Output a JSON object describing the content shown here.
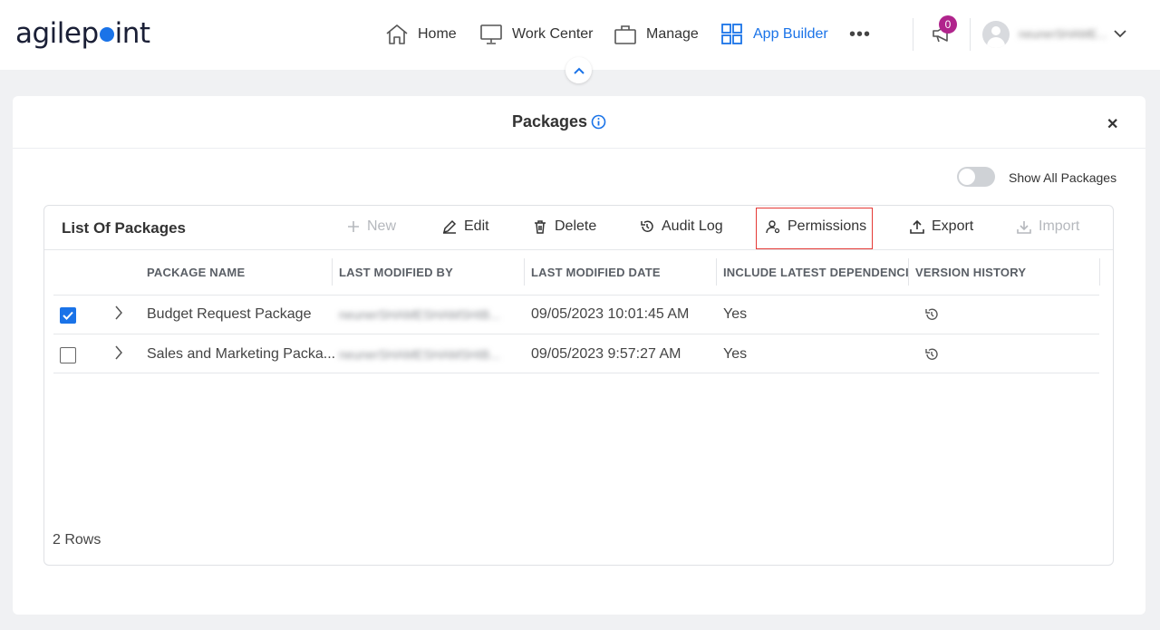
{
  "brand": {
    "logo_text_a": "agilep",
    "logo_text_b": "int",
    "accent": "#1a73e8"
  },
  "nav": {
    "home": "Home",
    "work_center": "Work Center",
    "manage": "Manage",
    "app_builder": "App Builder",
    "more": "•••",
    "notifications_count": "0",
    "user_name": "neunerSHAME..."
  },
  "panel": {
    "title": "Packages",
    "show_all_label": "Show All Packages"
  },
  "card": {
    "title": "List Of Packages",
    "toolbar": {
      "new": "New",
      "edit": "Edit",
      "delete": "Delete",
      "audit_log": "Audit Log",
      "permissions": "Permissions",
      "export": "Export",
      "import": "Import"
    },
    "columns": {
      "package_name": "PACKAGE NAME",
      "last_modified_by": "LAST MODIFIED BY",
      "last_modified_date": "LAST MODIFIED DATE",
      "include_latest": "INCLUDE LATEST DEPENDENCIES",
      "version_history": "VERSION HISTORY"
    },
    "rows": [
      {
        "selected": true,
        "name": "Budget Request Package",
        "modified_by": "neunerSHAMESHAMSHIB...",
        "modified_date": "09/05/2023 10:01:45 AM",
        "include_latest": "Yes"
      },
      {
        "selected": false,
        "name": "Sales and Marketing Packa...",
        "modified_by": "neunerSHAMESHAMSHIB...",
        "modified_date": "09/05/2023 9:57:27 AM",
        "include_latest": "Yes"
      }
    ],
    "rows_count": "2 Rows"
  }
}
